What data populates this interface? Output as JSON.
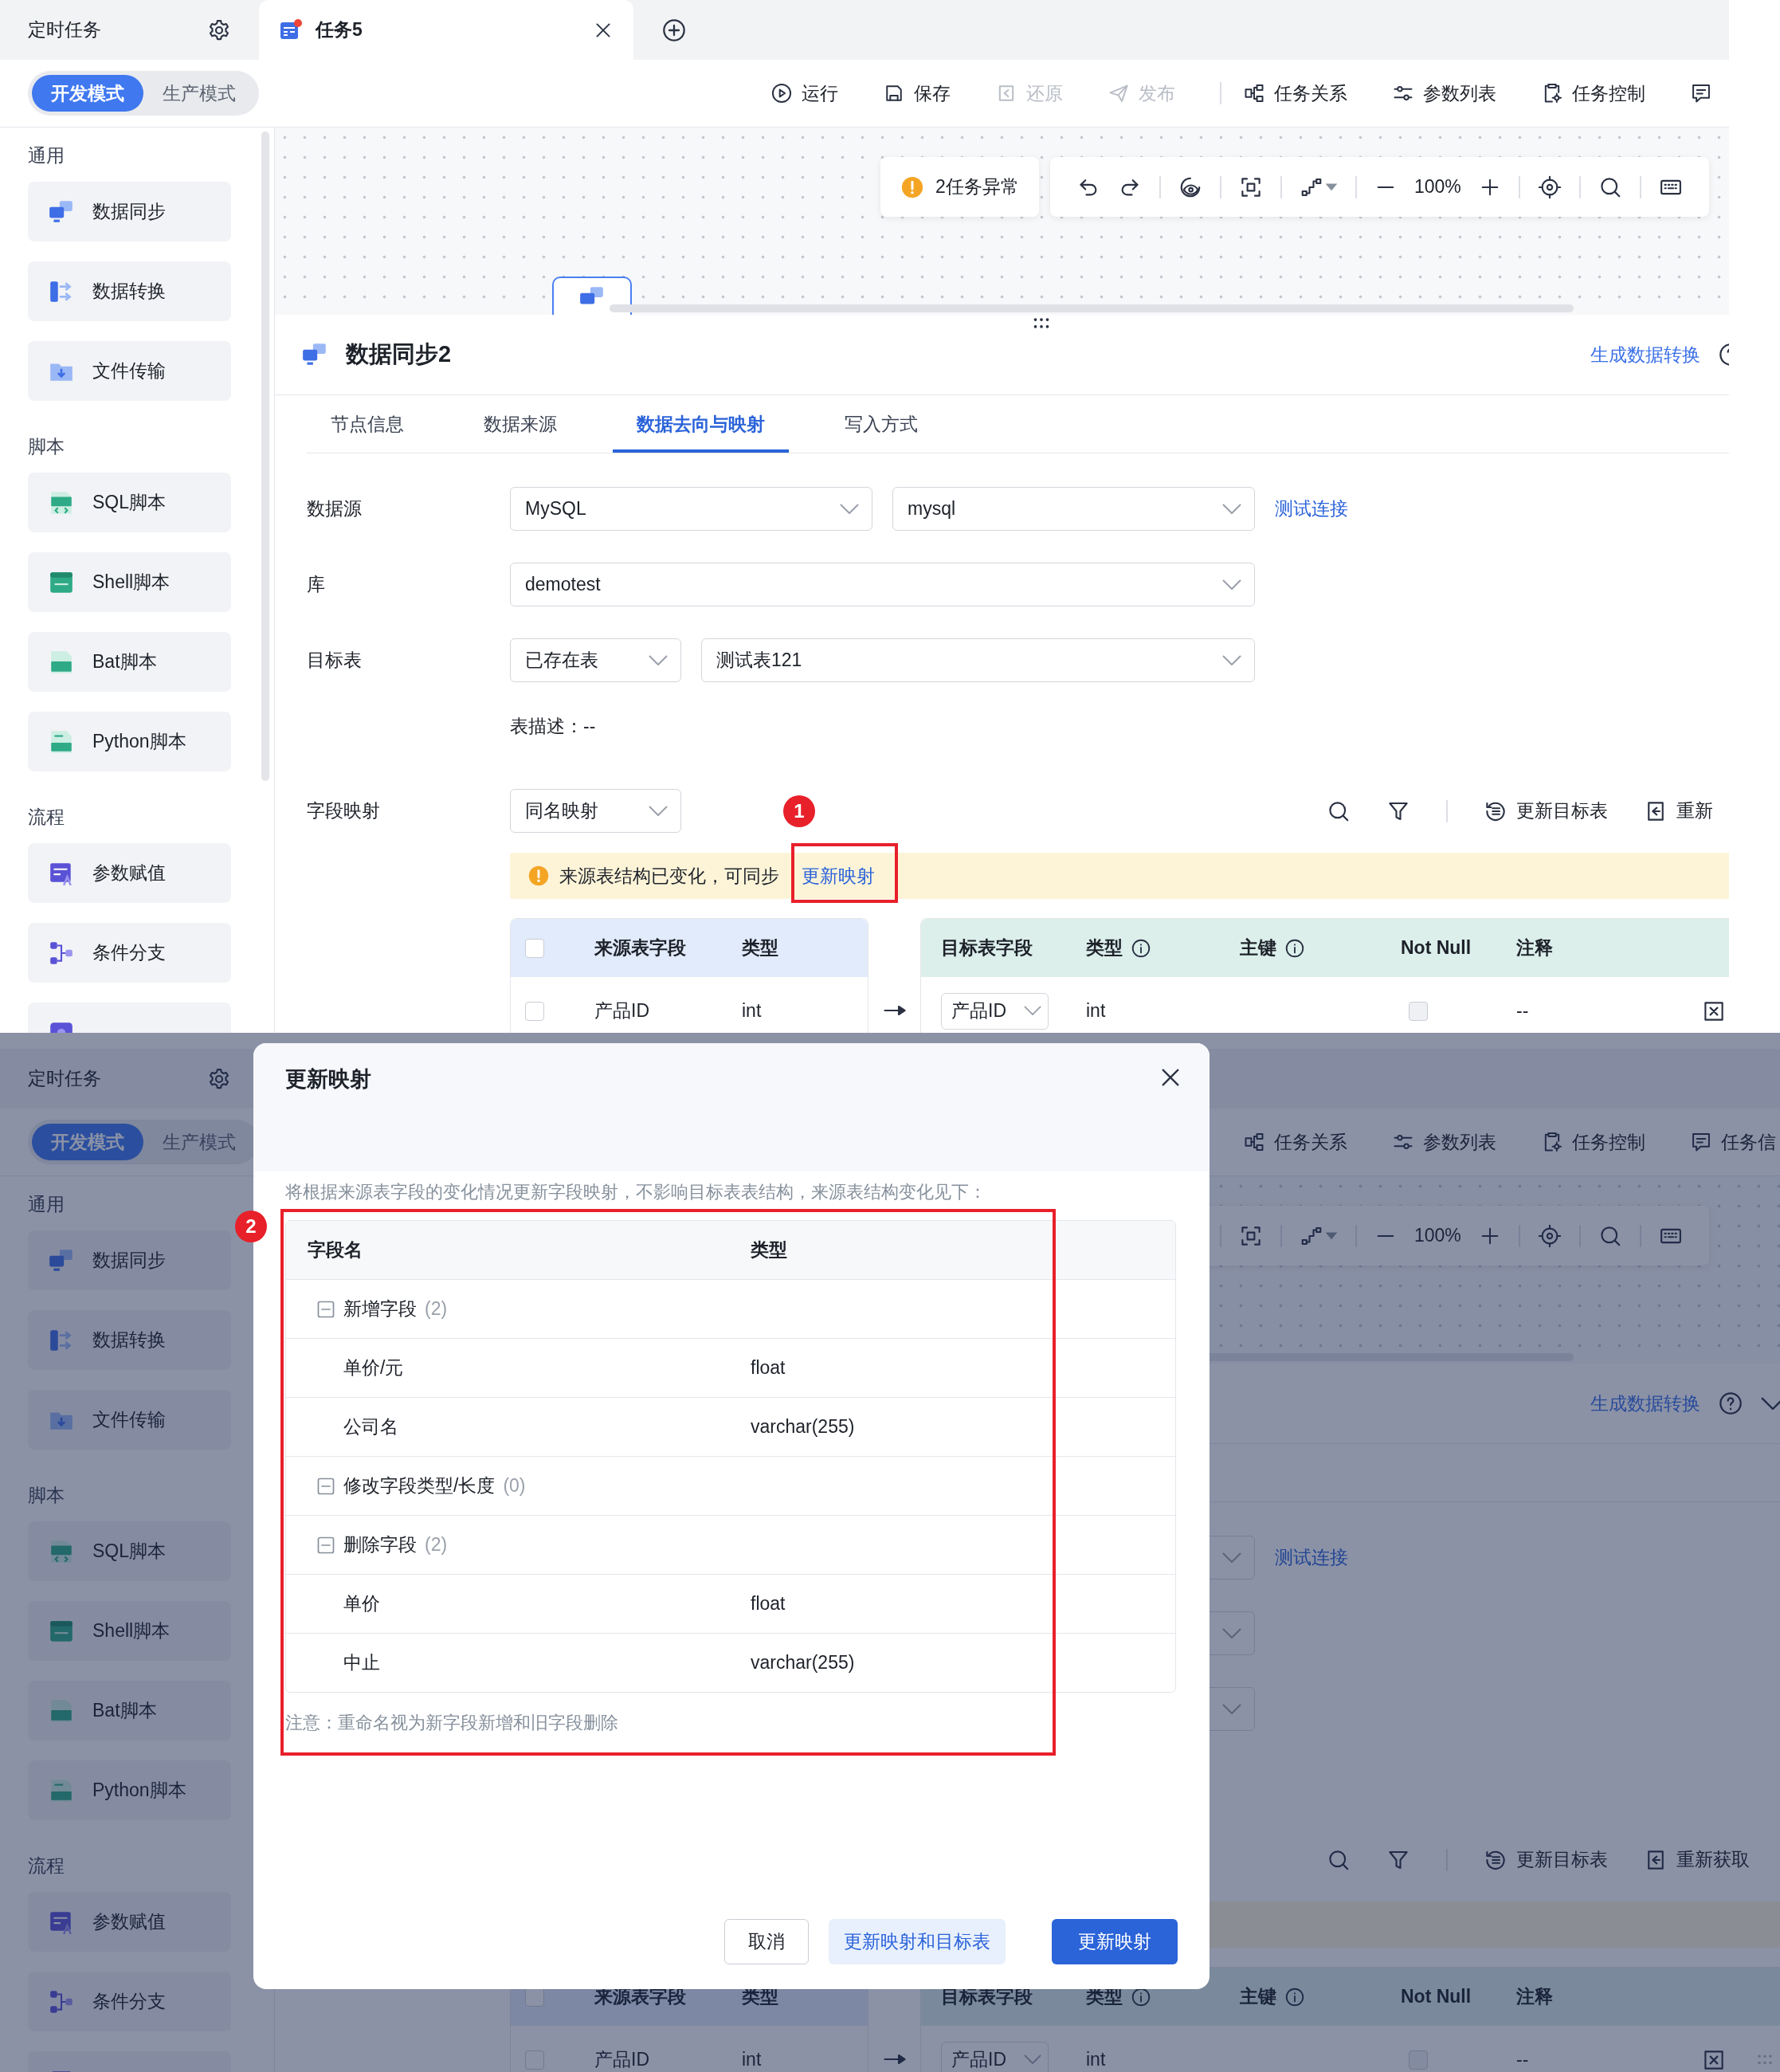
{
  "upper_screenshot": {
    "tab_bar": {
      "pinned_tab": {
        "label": "定时任务"
      },
      "tabs": [
        {
          "label": "任务5",
          "selected": true,
          "unsaved": true
        }
      ]
    },
    "mode_switch": [
      {
        "label": "开发模式",
        "selected": true
      },
      {
        "label": "生产模式",
        "selected": false
      }
    ],
    "run_actions": [
      {
        "label": "运行",
        "disabled": false
      },
      {
        "label": "保存",
        "disabled": false
      },
      {
        "label": "还原",
        "disabled": true
      },
      {
        "label": "发布",
        "disabled": true
      }
    ],
    "task_actions": [
      {
        "label": "任务关系"
      },
      {
        "label": "参数列表"
      },
      {
        "label": "任务控制"
      }
    ],
    "sidebar": {
      "groups": [
        {
          "title": "通用",
          "items": [
            {
              "kind": "sync",
              "label": "数据同步"
            },
            {
              "kind": "transform",
              "label": "数据转换"
            },
            {
              "kind": "file",
              "label": "文件传输"
            }
          ]
        },
        {
          "title": "脚本",
          "items": [
            {
              "kind": "sql",
              "label": "SQL脚本"
            },
            {
              "kind": "shell",
              "label": "Shell脚本"
            },
            {
              "kind": "bat",
              "label": "Bat脚本"
            },
            {
              "kind": "python",
              "label": "Python脚本"
            }
          ]
        },
        {
          "title": "流程",
          "items": [
            {
              "kind": "assign",
              "label": "参数赋值"
            },
            {
              "kind": "branch",
              "label": "条件分支"
            },
            {
              "kind": "call"
            }
          ]
        }
      ]
    },
    "canvas": {
      "warning": {
        "label": "2任务异常"
      },
      "zoom": "100%"
    },
    "node_panel": {
      "title": "数据同步2",
      "link": "生成数据转换",
      "tabs": [
        {
          "label": "节点信息",
          "selected": false
        },
        {
          "label": "数据来源",
          "selected": false
        },
        {
          "label": "数据去向与映射",
          "selected": true
        },
        {
          "label": "写入方式",
          "selected": false
        }
      ],
      "form_rows": [
        {
          "label": "数据源",
          "selects": [
            {
              "kind": "select",
              "value": "MySQL"
            },
            {
              "kind": "select",
              "value": "mysql"
            }
          ],
          "link": "测试连接"
        },
        {
          "label": "库",
          "selects": [
            {
              "kind": "select",
              "value": "demotest"
            }
          ]
        },
        {
          "label": "目标表",
          "selects": [
            {
              "kind": "select",
              "value": "已存在表"
            },
            {
              "kind": "select",
              "value": "测试表121"
            }
          ]
        }
      ],
      "table_description": "表描述：--",
      "field_mapping": {
        "label": "字段映射",
        "mode": "同名映射",
        "actions": [
          {
            "label": "更新目标表"
          },
          {
            "label": "重新"
          }
        ]
      },
      "banner": {
        "kind": "warning",
        "text": "来源表结构已变化，可同步",
        "link": "更新映射"
      },
      "mapping_table": {
        "source_header": [
          "来源表字段",
          "类型"
        ],
        "target_header": [
          "目标表字段",
          "类型",
          "主键",
          "Not Null",
          "注释"
        ],
        "all_selected": false,
        "rows": [
          {
            "selected": false,
            "source_field": "产品ID",
            "source_type": "int",
            "target_field": "产品ID",
            "target_type": "int",
            "not_null": false,
            "comment": "--"
          }
        ]
      }
    },
    "annotations": [
      {
        "label": "1"
      }
    ]
  },
  "lower_screenshot": {
    "tab_bar": {
      "pinned_tab": {
        "label": "定时任务"
      }
    },
    "mode_switch": [
      {
        "label": "开发模式",
        "selected": true
      },
      {
        "label": "生产模式",
        "selected": false
      }
    ],
    "task_actions": [
      {
        "label": "任务关系"
      },
      {
        "label": "参数列表"
      },
      {
        "label": "任务控制"
      }
    ],
    "task_info": {
      "label": "任务信"
    },
    "sidebar": {
      "groups": [
        {
          "title": "通用",
          "items": [
            {
              "kind": "sync",
              "label": "数据同步"
            },
            {
              "kind": "transform",
              "label": "数据转换"
            },
            {
              "kind": "file",
              "label": "文件传输"
            }
          ]
        },
        {
          "title": "脚本",
          "items": [
            {
              "kind": "sql",
              "label": "SQL脚本"
            },
            {
              "kind": "shell",
              "label": "Shell脚本"
            },
            {
              "kind": "bat",
              "label": "Bat脚本"
            },
            {
              "kind": "python",
              "label": "Python脚本"
            }
          ]
        },
        {
          "title": "流程",
          "items": [
            {
              "kind": "assign",
              "label": "参数赋值"
            },
            {
              "kind": "branch",
              "label": "条件分支"
            },
            {
              "kind": "call"
            }
          ]
        }
      ]
    },
    "canvas": {
      "zoom": "100%"
    },
    "node_panel": {
      "link": "生成数据转换",
      "form_rows": [
        {
          "selects": [
            {
              "kind": "select"
            }
          ],
          "link": "测试连接"
        },
        {
          "selects": [
            {
              "kind": "select"
            }
          ]
        },
        {
          "selects": [
            {
              "kind": "select"
            }
          ]
        }
      ],
      "field_mapping": {
        "actions": [
          {
            "label": "更新目标表"
          },
          {
            "label": "重新获取"
          }
        ]
      },
      "banner": {
        "kind": "warning"
      },
      "mapping_table": {
        "source_header": [
          "来源表字段",
          "类型"
        ],
        "target_header": [
          "目标表字段",
          "类型",
          "主键",
          "Not Null",
          "注释"
        ],
        "all_selected": false,
        "rows": [
          {
            "selected": false,
            "source_field": "产品ID",
            "source_type": "int",
            "target_field": "产品ID",
            "target_type": "int",
            "not_null": false,
            "comment": "--"
          }
        ]
      }
    },
    "dialog": {
      "title": "更新映射",
      "description": "将根据来源表字段的变化情况更新字段映射，不影响目标表表结构，来源表结构变化见下：",
      "columns": [
        "字段名",
        "类型"
      ],
      "groups": [
        {
          "label": "新增字段",
          "count": "(2)",
          "expanded": true,
          "children": [
            {
              "name": "单价/元",
              "type": "float"
            },
            {
              "name": "公司名",
              "type": "varchar(255)"
            }
          ]
        },
        {
          "label": "修改字段类型/长度",
          "count": "(0)",
          "expanded": true
        },
        {
          "label": "删除字段",
          "count": "(2)",
          "expanded": true,
          "children": [
            {
              "name": "单价",
              "type": "float"
            },
            {
              "name": "中止",
              "type": "varchar(255)"
            }
          ]
        }
      ],
      "note": "注意：重命名视为新字段新增和旧字段删除",
      "buttons": [
        {
          "label": "取消",
          "kind": "default"
        },
        {
          "label": "更新映射和目标表",
          "kind": "secondary"
        },
        {
          "label": "更新映射",
          "kind": "primary"
        }
      ]
    },
    "annotations": [
      {
        "label": "2"
      }
    ]
  }
}
